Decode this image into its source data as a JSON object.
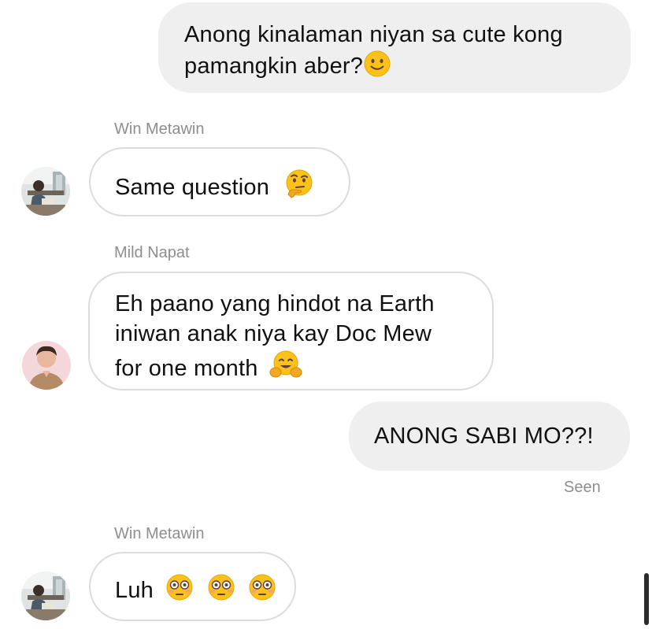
{
  "messages": [
    {
      "direction": "outgoing",
      "lines": [
        "Anong kinalaman niyan sa cute kong",
        "pamangkin aber?"
      ],
      "emoji": [
        "slightly-smiling-face-icon"
      ]
    },
    {
      "direction": "incoming",
      "sender": "Win Metawin",
      "lines": [
        "Same question"
      ],
      "emoji": [
        "thinking-face-icon"
      ]
    },
    {
      "direction": "incoming",
      "sender": "Mild Napat",
      "lines": [
        "Eh paano yang hindot na Earth",
        "iniwan anak niya kay Doc Mew",
        "for one month"
      ],
      "emoji": [
        "hugging-face-icon"
      ]
    },
    {
      "direction": "outgoing",
      "lines": [
        "ANONG SABI MO??!"
      ],
      "status": "Seen"
    },
    {
      "direction": "incoming",
      "sender": "Win Metawin",
      "lines": [
        "Luh"
      ],
      "emoji": [
        "flushed-face-icon",
        "flushed-face-icon",
        "flushed-face-icon"
      ]
    }
  ],
  "colors": {
    "outgoing_bubble": "#efefef",
    "incoming_border": "#dcdcdc",
    "meta_text": "#8e8e8e",
    "emoji_yellow": "#fcc21b"
  }
}
